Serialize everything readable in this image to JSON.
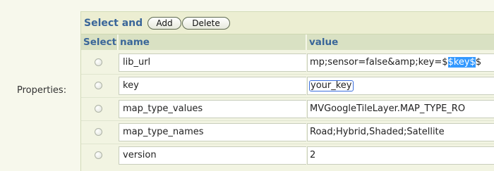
{
  "form": {
    "label": "Properties:"
  },
  "toolbar": {
    "text": "Select and",
    "add_label": "Add",
    "delete_label": "Delete"
  },
  "table": {
    "headers": {
      "select": "Select",
      "name": "name",
      "value": "value"
    },
    "rows": [
      {
        "name": "lib_url",
        "value_prefix": "mp;sensor=false&amp;key=$",
        "value_selected": "$key$",
        "value_suffix": "$"
      },
      {
        "name": "key",
        "value": "your_key"
      },
      {
        "name": "map_type_values",
        "value": "MVGoogleTileLayer.MAP_TYPE_RO"
      },
      {
        "name": "map_type_names",
        "value": "Road;Hybrid,Shaded;Satellite"
      },
      {
        "name": "version",
        "value": "2"
      }
    ]
  },
  "colors": {
    "header_text": "#3a6699",
    "background": "#f7f8ec",
    "selection": "#3399ff"
  }
}
